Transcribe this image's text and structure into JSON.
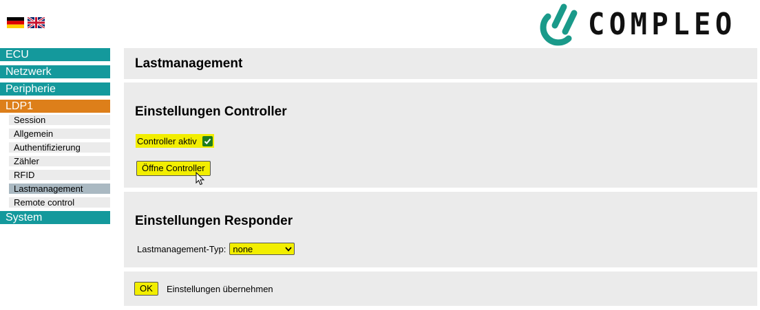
{
  "header": {
    "flags": [
      {
        "icon": "germany-flag-icon"
      },
      {
        "icon": "uk-flag-icon"
      }
    ],
    "logo_text": "COMPLEO",
    "brand_color": "#1a9a8a"
  },
  "sidebar": {
    "items": [
      {
        "label": "ECU"
      },
      {
        "label": "Netzwerk"
      },
      {
        "label": "Peripherie"
      },
      {
        "label": "LDP1",
        "active": true
      },
      {
        "label": "System"
      }
    ],
    "sub_items": [
      {
        "label": "Session"
      },
      {
        "label": "Allgemein"
      },
      {
        "label": "Authentifizierung"
      },
      {
        "label": "Zähler"
      },
      {
        "label": "RFID"
      },
      {
        "label": "Lastmanagement",
        "selected": true
      },
      {
        "label": "Remote control"
      }
    ],
    "colors": {
      "main": "#14999c",
      "active": "#dd7f1a",
      "sub": "#ebebeb",
      "sub_selected": "#aab9c2"
    }
  },
  "main": {
    "page_title": "Lastmanagement",
    "controller": {
      "heading": "Einstellungen Controller",
      "active_label": "Controller aktiv",
      "active_checked": true,
      "open_button": "Öffne Controller"
    },
    "responder": {
      "heading": "Einstellungen Responder",
      "type_label": "Lastmanagement-Typ:",
      "type_value": "none"
    },
    "apply": {
      "ok_button": "OK",
      "label": "Einstellungen übernehmen"
    },
    "highlight_color": "#f2ee00"
  }
}
